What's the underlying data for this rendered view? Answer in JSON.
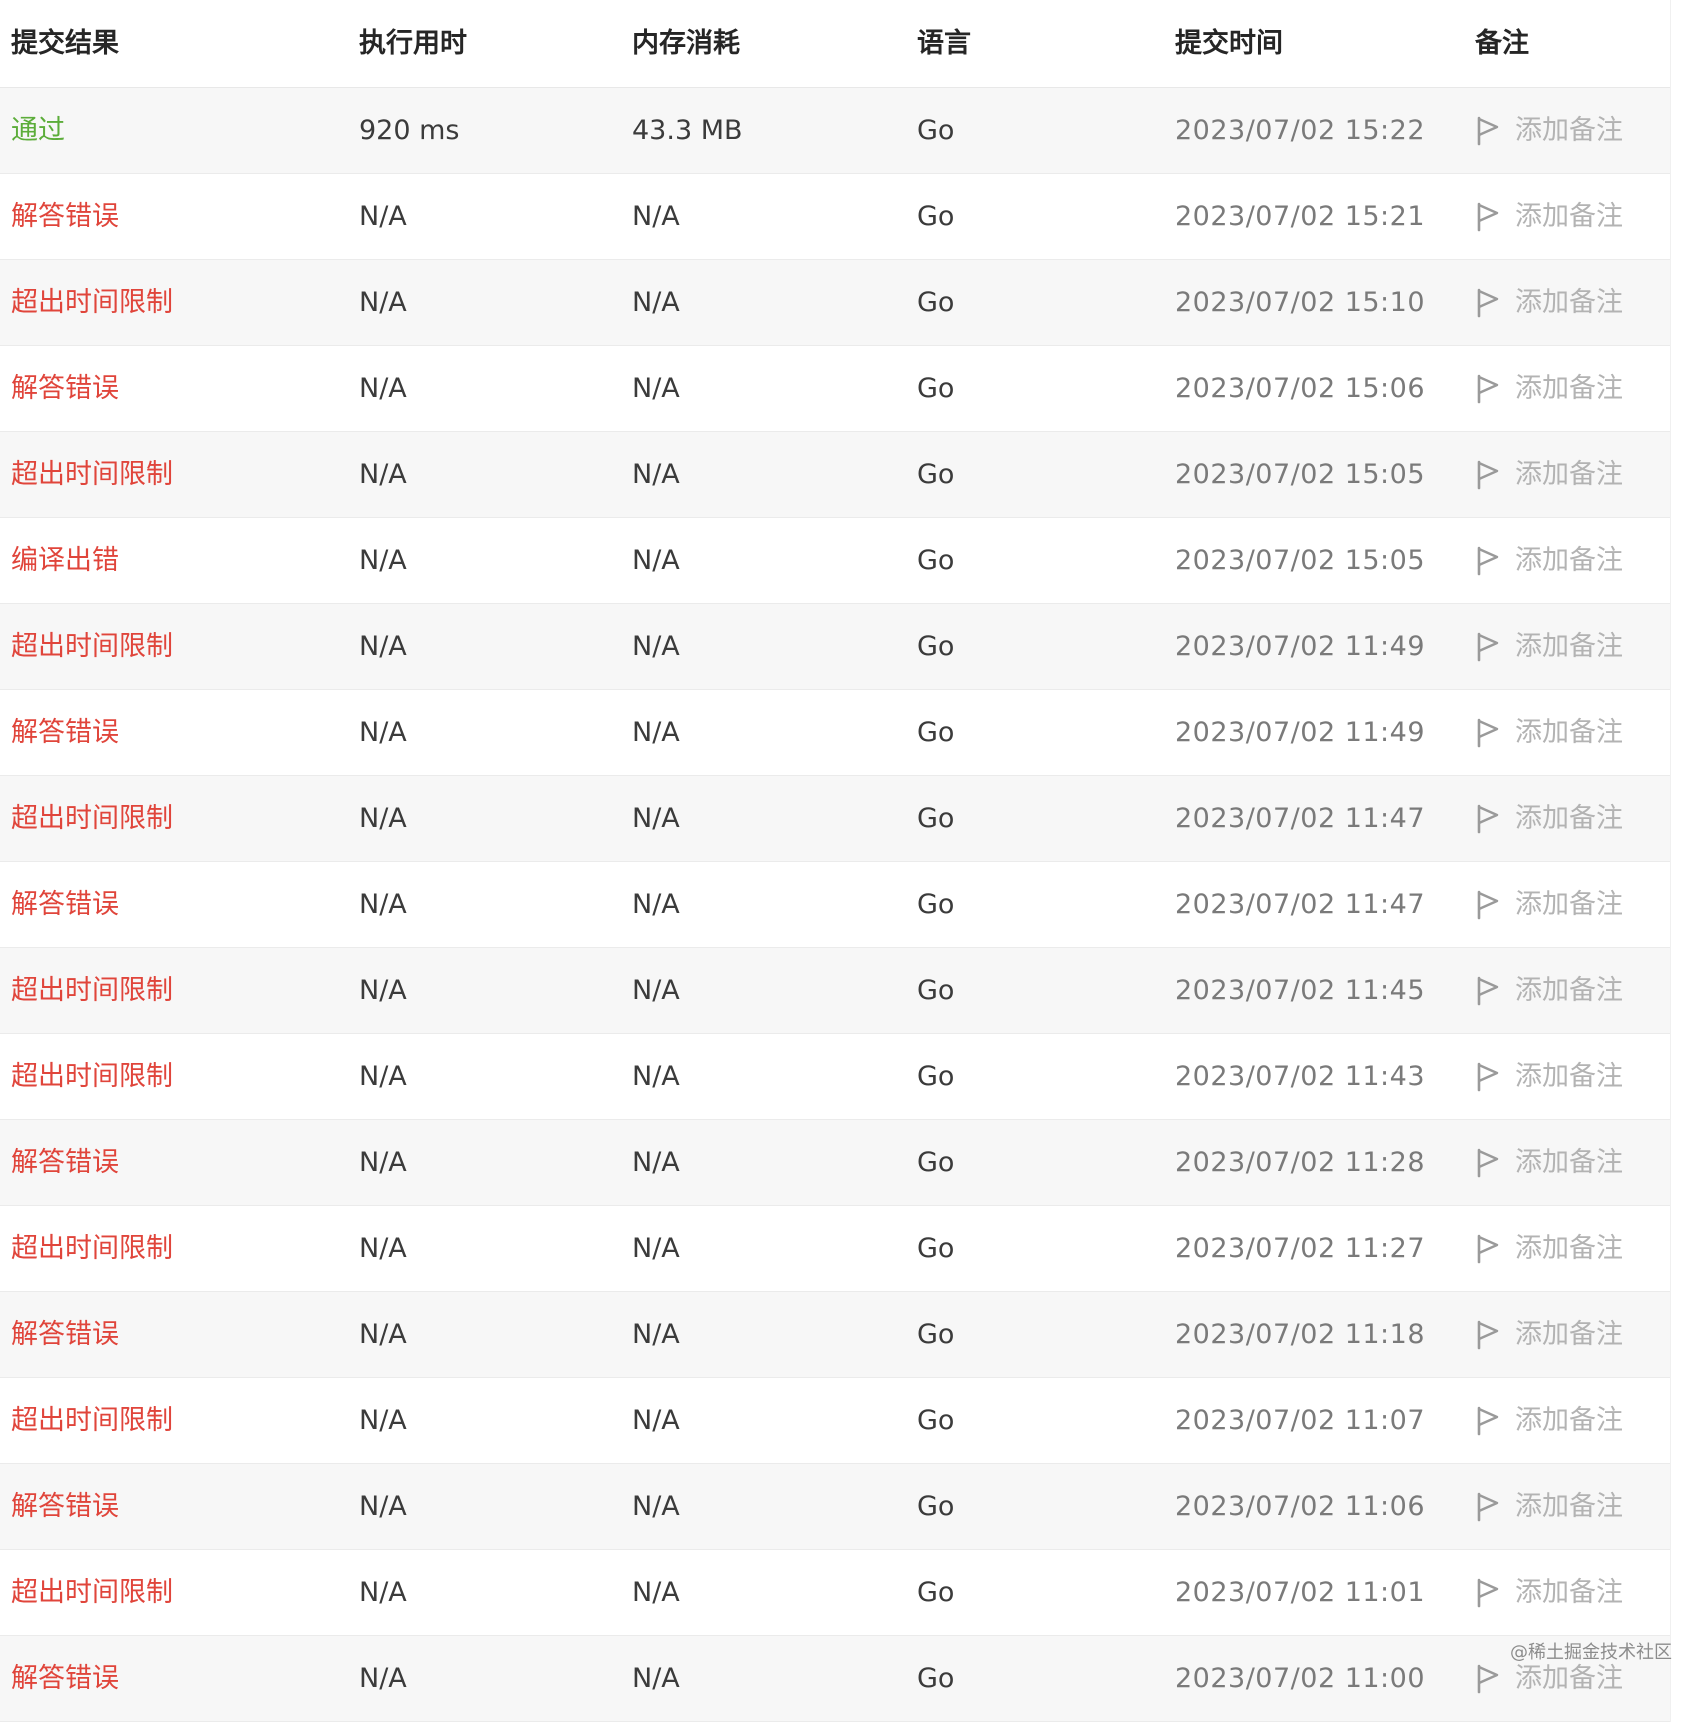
{
  "header": {
    "result": "提交结果",
    "exec_time": "执行用时",
    "memory": "内存消耗",
    "language": "语言",
    "submit_time": "提交时间",
    "note": "备注"
  },
  "colors": {
    "pass": "#5cad3a",
    "fail": "#e0453b",
    "row_alt": "#f7f7f7",
    "note_text": "#b3b3b3"
  },
  "rows": [
    {
      "result": "通过",
      "status": "pass",
      "time": "920 ms",
      "memory": "43.3 MB",
      "language": "Go",
      "submitted": "2023/07/02 15:22",
      "note": "添加备注"
    },
    {
      "result": "解答错误",
      "status": "fail",
      "time": "N/A",
      "memory": "N/A",
      "language": "Go",
      "submitted": "2023/07/02 15:21",
      "note": "添加备注"
    },
    {
      "result": "超出时间限制",
      "status": "fail",
      "time": "N/A",
      "memory": "N/A",
      "language": "Go",
      "submitted": "2023/07/02 15:10",
      "note": "添加备注"
    },
    {
      "result": "解答错误",
      "status": "fail",
      "time": "N/A",
      "memory": "N/A",
      "language": "Go",
      "submitted": "2023/07/02 15:06",
      "note": "添加备注"
    },
    {
      "result": "超出时间限制",
      "status": "fail",
      "time": "N/A",
      "memory": "N/A",
      "language": "Go",
      "submitted": "2023/07/02 15:05",
      "note": "添加备注"
    },
    {
      "result": "编译出错",
      "status": "fail",
      "time": "N/A",
      "memory": "N/A",
      "language": "Go",
      "submitted": "2023/07/02 15:05",
      "note": "添加备注"
    },
    {
      "result": "超出时间限制",
      "status": "fail",
      "time": "N/A",
      "memory": "N/A",
      "language": "Go",
      "submitted": "2023/07/02 11:49",
      "note": "添加备注"
    },
    {
      "result": "解答错误",
      "status": "fail",
      "time": "N/A",
      "memory": "N/A",
      "language": "Go",
      "submitted": "2023/07/02 11:49",
      "note": "添加备注"
    },
    {
      "result": "超出时间限制",
      "status": "fail",
      "time": "N/A",
      "memory": "N/A",
      "language": "Go",
      "submitted": "2023/07/02 11:47",
      "note": "添加备注"
    },
    {
      "result": "解答错误",
      "status": "fail",
      "time": "N/A",
      "memory": "N/A",
      "language": "Go",
      "submitted": "2023/07/02 11:47",
      "note": "添加备注"
    },
    {
      "result": "超出时间限制",
      "status": "fail",
      "time": "N/A",
      "memory": "N/A",
      "language": "Go",
      "submitted": "2023/07/02 11:45",
      "note": "添加备注"
    },
    {
      "result": "超出时间限制",
      "status": "fail",
      "time": "N/A",
      "memory": "N/A",
      "language": "Go",
      "submitted": "2023/07/02 11:43",
      "note": "添加备注"
    },
    {
      "result": "解答错误",
      "status": "fail",
      "time": "N/A",
      "memory": "N/A",
      "language": "Go",
      "submitted": "2023/07/02 11:28",
      "note": "添加备注"
    },
    {
      "result": "超出时间限制",
      "status": "fail",
      "time": "N/A",
      "memory": "N/A",
      "language": "Go",
      "submitted": "2023/07/02 11:27",
      "note": "添加备注"
    },
    {
      "result": "解答错误",
      "status": "fail",
      "time": "N/A",
      "memory": "N/A",
      "language": "Go",
      "submitted": "2023/07/02 11:18",
      "note": "添加备注"
    },
    {
      "result": "超出时间限制",
      "status": "fail",
      "time": "N/A",
      "memory": "N/A",
      "language": "Go",
      "submitted": "2023/07/02 11:07",
      "note": "添加备注"
    },
    {
      "result": "解答错误",
      "status": "fail",
      "time": "N/A",
      "memory": "N/A",
      "language": "Go",
      "submitted": "2023/07/02 11:06",
      "note": "添加备注"
    },
    {
      "result": "超出时间限制",
      "status": "fail",
      "time": "N/A",
      "memory": "N/A",
      "language": "Go",
      "submitted": "2023/07/02 11:01",
      "note": "添加备注"
    },
    {
      "result": "解答错误",
      "status": "fail",
      "time": "N/A",
      "memory": "N/A",
      "language": "Go",
      "submitted": "2023/07/02 11:00",
      "note": "添加备注"
    }
  ],
  "watermark": "@稀土掘金技术社区",
  "icons": {
    "note": "flag-icon"
  }
}
